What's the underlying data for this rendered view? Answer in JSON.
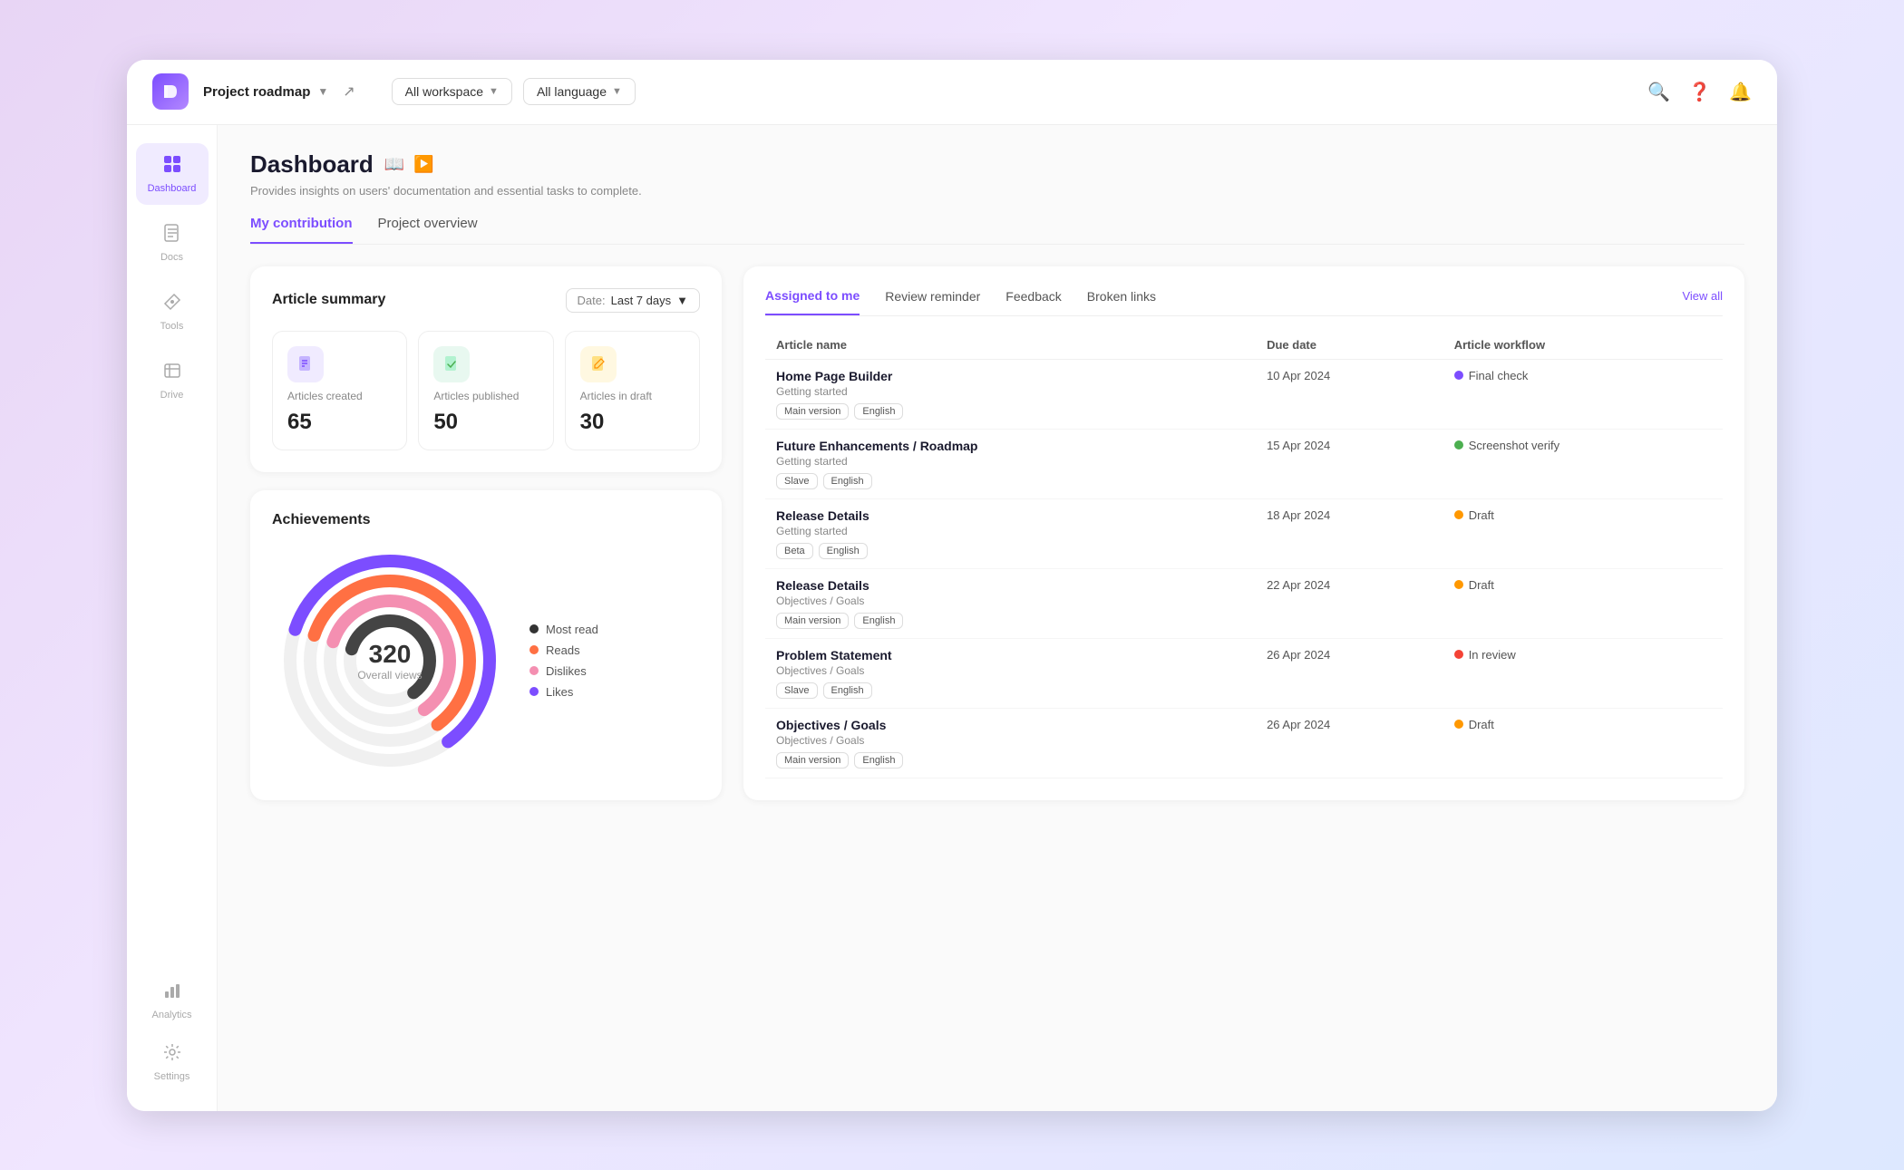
{
  "topbar": {
    "logo_text": "D",
    "project_name": "Project roadmap",
    "workspace_filter": "All workspace",
    "language_filter": "All language",
    "ext_link_label": "↗"
  },
  "sidebar": {
    "items": [
      {
        "id": "dashboard",
        "label": "Dashboard",
        "icon": "🏠",
        "active": true
      },
      {
        "id": "docs",
        "label": "Docs",
        "icon": "📚",
        "active": false
      },
      {
        "id": "tools",
        "label": "Tools",
        "icon": "🔧",
        "active": false
      },
      {
        "id": "drive",
        "label": "Drive",
        "icon": "🗄",
        "active": false
      }
    ],
    "bottom_items": [
      {
        "id": "analytics",
        "label": "Analytics",
        "icon": "📊",
        "active": false
      },
      {
        "id": "settings",
        "label": "Settings",
        "icon": "⚙️",
        "active": false
      }
    ]
  },
  "dashboard": {
    "title": "Dashboard",
    "subtitle": "Provides insights on users' documentation and essential tasks to complete.",
    "tabs": [
      {
        "id": "my-contribution",
        "label": "My contribution",
        "active": true
      },
      {
        "id": "project-overview",
        "label": "Project overview",
        "active": false
      }
    ]
  },
  "article_summary": {
    "title": "Article summary",
    "date_label": "Date:",
    "date_value": "Last 7 days",
    "stats": [
      {
        "id": "created",
        "label": "Articles created",
        "value": "65",
        "icon": "📄",
        "icon_class": "purple"
      },
      {
        "id": "published",
        "label": "Articles published",
        "value": "50",
        "icon": "📋",
        "icon_class": "green"
      },
      {
        "id": "draft",
        "label": "Articles in draft",
        "value": "30",
        "icon": "✏️",
        "icon_class": "yellow"
      }
    ]
  },
  "achievements": {
    "title": "Achievements",
    "overall_views": "320",
    "overall_views_label": "Overall views",
    "legend": [
      {
        "label": "Most read",
        "color": "#333"
      },
      {
        "label": "Reads",
        "color": "#ff7043"
      },
      {
        "label": "Dislikes",
        "color": "#f48fb1"
      },
      {
        "label": "Likes",
        "color": "#7c4dff"
      }
    ]
  },
  "right_panel": {
    "tabs": [
      {
        "id": "assigned",
        "label": "Assigned to me",
        "active": true
      },
      {
        "id": "review",
        "label": "Review reminder",
        "active": false
      },
      {
        "id": "feedback",
        "label": "Feedback",
        "active": false
      },
      {
        "id": "broken",
        "label": "Broken links",
        "active": false
      }
    ],
    "view_all": "View all",
    "columns": [
      "Article name",
      "Due date",
      "Article workflow"
    ],
    "articles": [
      {
        "name": "Home Page Builder",
        "section": "Getting started",
        "tags": [
          "Main version",
          "English"
        ],
        "due_date": "10 Apr 2024",
        "workflow": "Final check",
        "workflow_color": "dot-purple"
      },
      {
        "name": "Future Enhancements / Roadmap",
        "section": "Getting started",
        "tags": [
          "Slave",
          "English"
        ],
        "due_date": "15 Apr 2024",
        "workflow": "Screenshot verify",
        "workflow_color": "dot-green"
      },
      {
        "name": "Release Details",
        "section": "Getting started",
        "tags": [
          "Beta",
          "English"
        ],
        "due_date": "18 Apr 2024",
        "workflow": "Draft",
        "workflow_color": "dot-orange"
      },
      {
        "name": "Release Details",
        "section": "Objectives / Goals",
        "tags": [
          "Main version",
          "English"
        ],
        "due_date": "22 Apr 2024",
        "workflow": "Draft",
        "workflow_color": "dot-orange"
      },
      {
        "name": "Problem Statement",
        "section": "Objectives / Goals",
        "tags": [
          "Slave",
          "English"
        ],
        "due_date": "26 Apr 2024",
        "workflow": "In review",
        "workflow_color": "dot-red"
      },
      {
        "name": "Objectives / Goals",
        "section": "Objectives / Goals",
        "tags": [
          "Main version",
          "English"
        ],
        "due_date": "26 Apr 2024",
        "workflow": "Draft",
        "workflow_color": "dot-orange"
      }
    ]
  }
}
